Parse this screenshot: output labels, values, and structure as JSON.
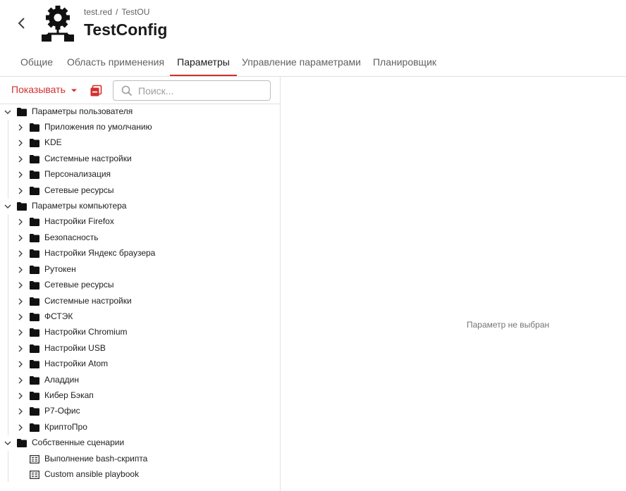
{
  "header": {
    "breadcrumb": [
      "test.red",
      "TestOU"
    ],
    "breadcrumb_sep": "/",
    "title": "TestConfig",
    "icons": {
      "back": "chevron-left-icon",
      "logo": "gear-network-icon"
    }
  },
  "tabs": [
    {
      "label": "Общие",
      "active": false
    },
    {
      "label": "Область применения",
      "active": false
    },
    {
      "label": "Параметры",
      "active": true
    },
    {
      "label": "Управление параметрами",
      "active": false
    },
    {
      "label": "Планировщик",
      "active": false
    }
  ],
  "toolbar": {
    "show_label": "Показывать",
    "search_placeholder": "Поиск...",
    "icons": {
      "show_caret": "caret-down-icon",
      "collapse": "collapse-all-icon",
      "search": "search-icon"
    }
  },
  "tree": [
    {
      "label": "Параметры пользователя",
      "expanded": true,
      "icon": "folder-icon",
      "children": [
        {
          "label": "Приложения по умолчанию",
          "icon": "folder-icon"
        },
        {
          "label": "KDE",
          "icon": "folder-icon"
        },
        {
          "label": "Системные настройки",
          "icon": "folder-icon"
        },
        {
          "label": "Персонализация",
          "icon": "folder-icon"
        },
        {
          "label": "Сетевые ресурсы",
          "icon": "folder-icon"
        }
      ]
    },
    {
      "label": "Параметры компьютера",
      "expanded": true,
      "icon": "folder-icon",
      "children": [
        {
          "label": "Настройки Firefox",
          "icon": "folder-icon"
        },
        {
          "label": "Безопасность",
          "icon": "folder-icon"
        },
        {
          "label": "Настройки Яндекс браузера",
          "icon": "folder-icon"
        },
        {
          "label": "Рутокен",
          "icon": "folder-icon"
        },
        {
          "label": "Сетевые ресурсы",
          "icon": "folder-icon"
        },
        {
          "label": "Системные настройки",
          "icon": "folder-icon"
        },
        {
          "label": "ФСТЭК",
          "icon": "folder-icon"
        },
        {
          "label": "Настройки Chromium",
          "icon": "folder-icon"
        },
        {
          "label": "Настройки USB",
          "icon": "folder-icon"
        },
        {
          "label": "Настройки Atom",
          "icon": "folder-icon"
        },
        {
          "label": "Аладдин",
          "icon": "folder-icon"
        },
        {
          "label": "Кибер Бэкап",
          "icon": "folder-icon"
        },
        {
          "label": "Р7-Офис",
          "icon": "folder-icon"
        },
        {
          "label": "КриптоПро",
          "icon": "folder-icon"
        }
      ]
    },
    {
      "label": "Собственные сценарии",
      "expanded": true,
      "icon": "folder-icon",
      "children": [
        {
          "label": "Выполнение bash-скрипта",
          "icon": "script-icon",
          "leaf": true
        },
        {
          "label": "Custom ansible playbook",
          "icon": "script-icon",
          "leaf": true
        }
      ]
    }
  ],
  "detail": {
    "empty_text": "Параметр не выбран"
  },
  "colors": {
    "accent": "#d32f2f",
    "text": "#212121",
    "muted": "#616161",
    "border": "#e0e0e0"
  }
}
